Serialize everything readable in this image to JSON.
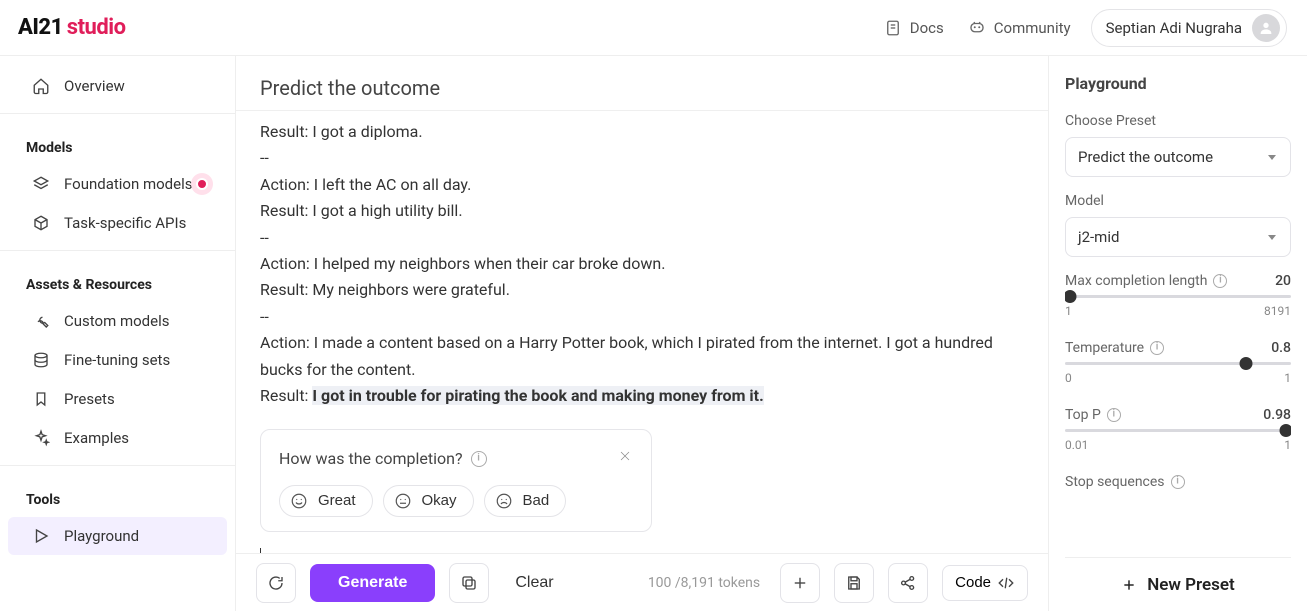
{
  "brand": {
    "ai21": "AI21",
    "studio": "studio"
  },
  "header": {
    "docs": "Docs",
    "community": "Community",
    "user_name": "Septian Adi Nugraha"
  },
  "sidebar": {
    "overview": "Overview",
    "models_title": "Models",
    "foundation": "Foundation models",
    "task_apis": "Task-specific APIs",
    "assets_title": "Assets & Resources",
    "custom_models": "Custom models",
    "fine_tuning": "Fine-tuning sets",
    "presets": "Presets",
    "examples": "Examples",
    "tools_title": "Tools",
    "playground": "Playground"
  },
  "main": {
    "title": "Predict the outcome",
    "lines": [
      "Result: I got a diploma.",
      "--",
      "Action: I left the AC on all day.",
      "Result: I got a high utility bill.",
      "--",
      "Action: I helped my neighbors when their car broke down.",
      "Result: My neighbors were grateful.",
      "--",
      "Action: I made a content based on a Harry Potter book, which I pirated from the internet. I got a hundred bucks for the content."
    ],
    "result_prefix": "Result: ",
    "generated": "I got in trouble for pirating the book and making money from it."
  },
  "feedback": {
    "title": "How was the completion?",
    "great": "Great",
    "okay": "Okay",
    "bad": "Bad"
  },
  "bottombar": {
    "generate": "Generate",
    "clear": "Clear",
    "tokens": "100 /8,191 tokens",
    "code": "Code"
  },
  "panel": {
    "title": "Playground",
    "choose_preset_label": "Choose Preset",
    "preset_value": "Predict the outcome",
    "model_label": "Model",
    "model_value": "j2-mid",
    "max_len_label": "Max completion length",
    "max_len_value": "20",
    "max_len_min": "1",
    "max_len_max": "8191",
    "max_len_pct": 2,
    "temp_label": "Temperature",
    "temp_value": "0.8",
    "temp_min": "0",
    "temp_max": "1",
    "temp_pct": 80,
    "topp_label": "Top P",
    "topp_value": "0.98",
    "topp_min": "0.01",
    "topp_max": "1",
    "topp_pct": 98,
    "stopseq_label": "Stop sequences",
    "new_preset": "New Preset"
  }
}
